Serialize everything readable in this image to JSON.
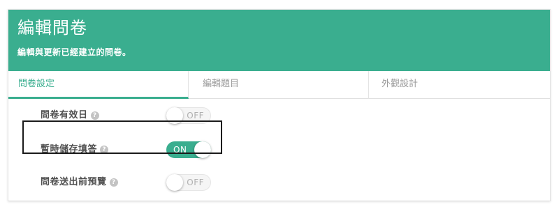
{
  "header": {
    "title": "編輯問卷",
    "subtitle": "編輯與更新已經建立的問卷。"
  },
  "tabs": [
    {
      "label": "問卷設定",
      "active": true
    },
    {
      "label": "編輯題目",
      "active": false
    },
    {
      "label": "外觀設計",
      "active": false
    }
  ],
  "settings": [
    {
      "label": "問卷有效日",
      "help": "?",
      "state": "OFF"
    },
    {
      "label": "暫時儲存填答",
      "help": "?",
      "state": "ON"
    },
    {
      "label": "問卷送出前預覽",
      "help": "?",
      "state": "OFF"
    }
  ],
  "colors": {
    "accent": "#3aae8f",
    "toggle_off": "#f5f5f5",
    "help_icon": "#c3c3c3"
  },
  "icons": {
    "help": "question-circle-icon"
  }
}
